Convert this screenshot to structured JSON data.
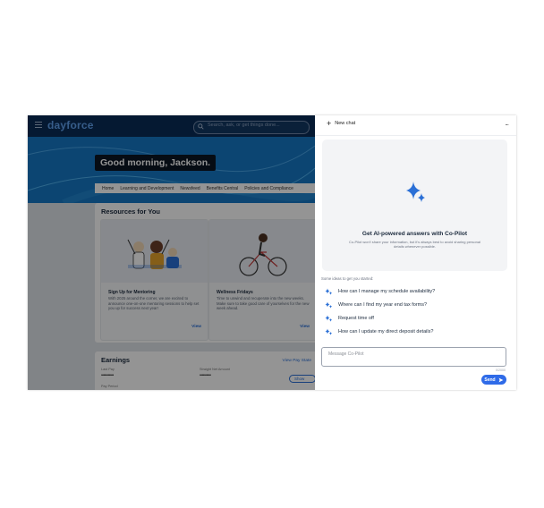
{
  "app": {
    "logo": "dayforce",
    "search_placeholder": "Search, ask, or get things done...",
    "greeting": "Good morning, Jackson.",
    "nav_tabs": [
      "Home",
      "Learning and Development",
      "Newsfeed",
      "Benefits Central",
      "Policies and Compliance"
    ],
    "resources_title": "Resources for You",
    "cards": [
      {
        "title": "Sign Up for Mentoring",
        "desc": "With 2025 around the corner, we are excited to announce one-on-one mentoring sessions to help set you up for success next year!",
        "view": "View"
      },
      {
        "title": "Wellness Fridays",
        "desc": "Time to unwind and recuperate into the new weeks. Make sure to take good care of yourselves for the new week ahead.",
        "view": "View"
      }
    ],
    "earnings": {
      "title": "Earnings",
      "view_pay": "View Pay State",
      "last_pay": "Last Pay",
      "straight": "Straight Net Amount",
      "masked1": "•••••••••••",
      "masked2": "••••••••••",
      "show": "Show",
      "period": "Pay Period"
    }
  },
  "copilot": {
    "new_chat": "New chat",
    "more": "...",
    "welcome_title": "Get AI-powered answers with Co-Pilot",
    "welcome_sub": "Co-Pilot won't share your information, but it's always best to avoid sharing personal details whenever possible.",
    "ideas_label": "Some ideas to get you started:",
    "suggestions": [
      "How can I manage my schedule availability?",
      "Where can I find my year end tax forms?",
      "Request time off",
      "How can I update my direct deposit details?"
    ],
    "message_placeholder": "Message Co-Pilot",
    "char_count": "0/2000",
    "send_label": "Send",
    "accent": "#2f6be8"
  }
}
